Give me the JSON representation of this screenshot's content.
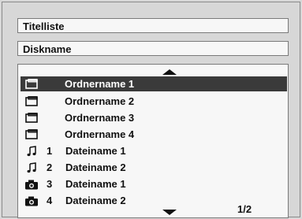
{
  "header": {
    "title_list": "Titelliste",
    "disc_name": "Diskname"
  },
  "list": {
    "items": [
      {
        "icon": "folder-icon",
        "num": "",
        "label": "Ordnername 1",
        "selected": true
      },
      {
        "icon": "folder-icon",
        "num": "",
        "label": "Ordnername 2",
        "selected": false
      },
      {
        "icon": "folder-icon",
        "num": "",
        "label": "Ordnername 3",
        "selected": false
      },
      {
        "icon": "folder-icon",
        "num": "",
        "label": "Ordnername 4",
        "selected": false
      },
      {
        "icon": "music-note-icon",
        "num": "1",
        "label": "Dateiname 1",
        "selected": false
      },
      {
        "icon": "music-note-icon",
        "num": "2",
        "label": "Dateiname 2",
        "selected": false
      },
      {
        "icon": "camera-icon",
        "num": "3",
        "label": "Dateiname 1",
        "selected": false
      },
      {
        "icon": "camera-icon",
        "num": "4",
        "label": "Dateiname 2",
        "selected": false
      }
    ],
    "page_indicator": "1/2"
  }
}
